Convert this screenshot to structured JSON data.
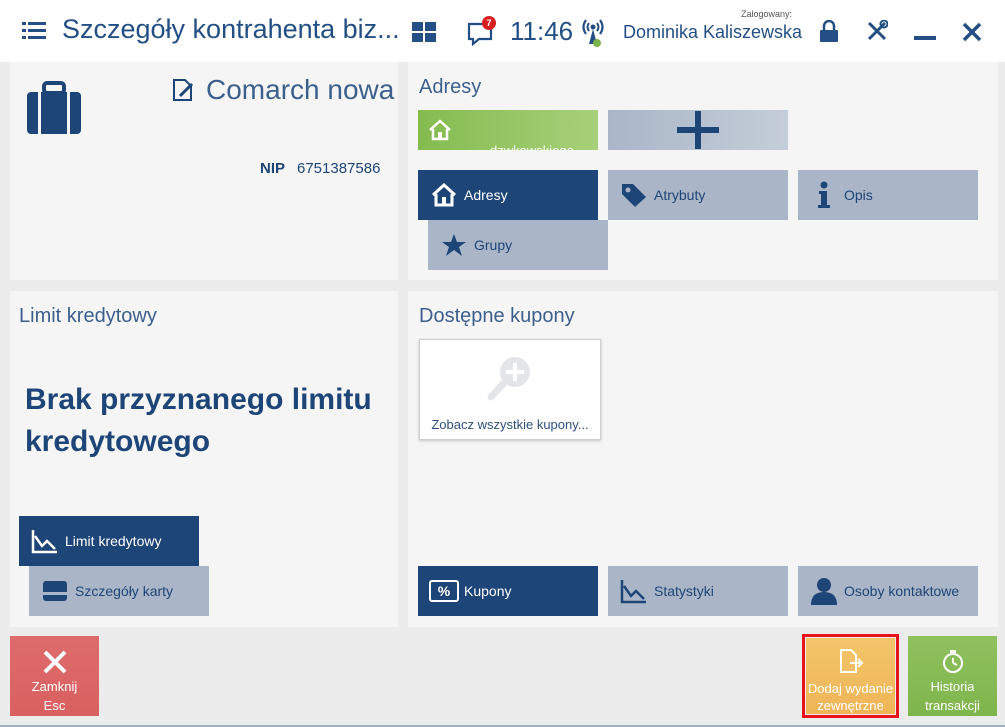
{
  "header": {
    "title": "Szczegóły kontrahenta biz...",
    "notification_count": "7",
    "time": "11:46",
    "logged_label": "Zalogowany:",
    "user_name": "Dominika Kaliszewska"
  },
  "company": {
    "name": "Comarch nowa",
    "nip_label": "NIP",
    "nip_value": "6751387586"
  },
  "addresses": {
    "title": "Adresy",
    "address_tile_text": "dzwkowskiego",
    "tiles": [
      {
        "label": "Adresy",
        "icon": "home-icon"
      },
      {
        "label": "Atrybuty",
        "icon": "tag-icon"
      },
      {
        "label": "Opis",
        "icon": "info-icon"
      },
      {
        "label": "Grupy",
        "icon": "star-icon"
      }
    ]
  },
  "credit": {
    "title": "Limit kredytowy",
    "message": "Brak przyznanego limitu kredytowego",
    "tiles": [
      {
        "label": "Limit kredytowy",
        "icon": "chart-icon"
      },
      {
        "label": "Szczegóły karty",
        "icon": "card-icon"
      }
    ]
  },
  "coupons": {
    "title": "Dostępne kupony",
    "see_all": "Zobacz wszystkie kupony...",
    "tiles": [
      {
        "label": "Kupony",
        "icon": "percent-icon"
      },
      {
        "label": "Statystyki",
        "icon": "chart-icon"
      },
      {
        "label": "Osoby kontaktowe",
        "icon": "person-icon"
      }
    ]
  },
  "footer": {
    "close_line1": "Zamknij",
    "close_line2": "Esc",
    "add_line1": "Dodaj wydanie",
    "add_line2": "zewnętrzne",
    "history_line1": "Historia",
    "history_line2": "transakcji"
  },
  "colors": {
    "dark_blue": "#1e4577",
    "light_tile": "#aab6c7",
    "green": "#8fc15e",
    "red": "#dd6c6c",
    "orange": "#f1bc5e",
    "highlight": "#e8141c"
  }
}
